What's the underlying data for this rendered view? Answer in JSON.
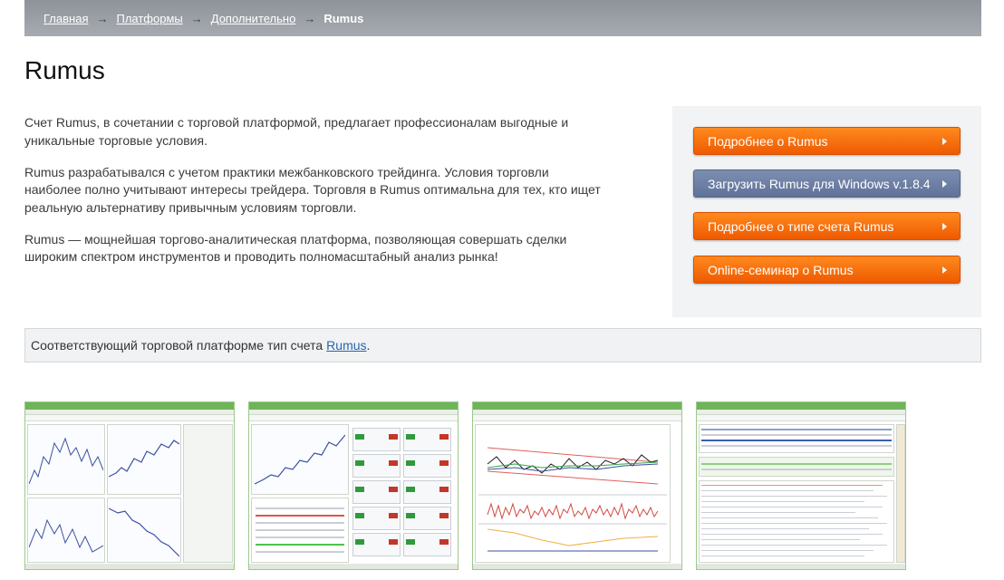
{
  "breadcrumb": {
    "items": [
      "Главная",
      "Платформы",
      "Дополнительно"
    ],
    "separator": "→",
    "current": "Rumus"
  },
  "page": {
    "title": "Rumus"
  },
  "intro": {
    "paragraphs": [
      "Счет Rumus, в сочетании с торговой платформой, предлагает профессионалам выгодные и уникальные торговые условия.",
      "Rumus разрабатывался с учетом практики межбанковского трейдинга. Условия торговли наиболее полно учитывают интересы трейдера. Торговля в Rumus оптимальна для тех, кто ищет реальную альтернативу привычным условиям торговли.",
      "Rumus — мощнейшая торгово-аналитическая платформа, позволяющая совершать сделки широким спектром инструментов и проводить полномасштабный анализ рынка!"
    ]
  },
  "side": {
    "buttons": [
      {
        "label": "Подробнее о Rumus",
        "style": "orange"
      },
      {
        "label": "Загрузить Rumus для Windows v.1.8.4",
        "style": "blue"
      },
      {
        "label": "Подробнее о типе счета Rumus",
        "style": "orange"
      },
      {
        "label": "Online-семинар о Rumus",
        "style": "orange"
      }
    ]
  },
  "note": {
    "text": "Соответствующий торговой платформе тип счета",
    "link": "Rumus",
    "suffix": "."
  },
  "colors": {
    "orange": "#f06a00",
    "blue": "#6a7ca3",
    "link": "#2a63a8",
    "breadcrumb_bg": "#9ba0a6"
  }
}
